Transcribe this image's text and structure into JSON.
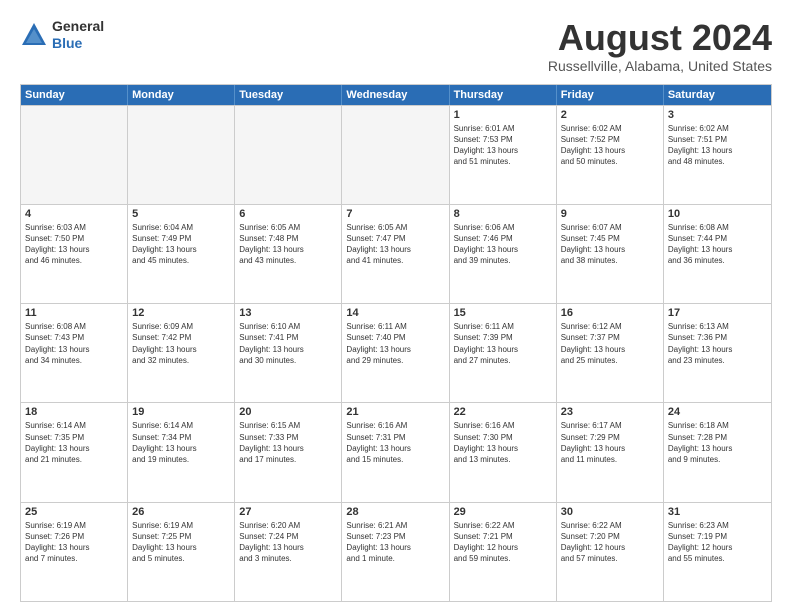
{
  "header": {
    "logo_general": "General",
    "logo_blue": "Blue",
    "month_year": "August 2024",
    "location": "Russellville, Alabama, United States"
  },
  "days_of_week": [
    "Sunday",
    "Monday",
    "Tuesday",
    "Wednesday",
    "Thursday",
    "Friday",
    "Saturday"
  ],
  "rows": [
    [
      {
        "day": "",
        "text": "",
        "empty": true
      },
      {
        "day": "",
        "text": "",
        "empty": true
      },
      {
        "day": "",
        "text": "",
        "empty": true
      },
      {
        "day": "",
        "text": "",
        "empty": true
      },
      {
        "day": "1",
        "text": "Sunrise: 6:01 AM\nSunset: 7:53 PM\nDaylight: 13 hours\nand 51 minutes.",
        "empty": false
      },
      {
        "day": "2",
        "text": "Sunrise: 6:02 AM\nSunset: 7:52 PM\nDaylight: 13 hours\nand 50 minutes.",
        "empty": false
      },
      {
        "day": "3",
        "text": "Sunrise: 6:02 AM\nSunset: 7:51 PM\nDaylight: 13 hours\nand 48 minutes.",
        "empty": false
      }
    ],
    [
      {
        "day": "4",
        "text": "Sunrise: 6:03 AM\nSunset: 7:50 PM\nDaylight: 13 hours\nand 46 minutes.",
        "empty": false
      },
      {
        "day": "5",
        "text": "Sunrise: 6:04 AM\nSunset: 7:49 PM\nDaylight: 13 hours\nand 45 minutes.",
        "empty": false
      },
      {
        "day": "6",
        "text": "Sunrise: 6:05 AM\nSunset: 7:48 PM\nDaylight: 13 hours\nand 43 minutes.",
        "empty": false
      },
      {
        "day": "7",
        "text": "Sunrise: 6:05 AM\nSunset: 7:47 PM\nDaylight: 13 hours\nand 41 minutes.",
        "empty": false
      },
      {
        "day": "8",
        "text": "Sunrise: 6:06 AM\nSunset: 7:46 PM\nDaylight: 13 hours\nand 39 minutes.",
        "empty": false
      },
      {
        "day": "9",
        "text": "Sunrise: 6:07 AM\nSunset: 7:45 PM\nDaylight: 13 hours\nand 38 minutes.",
        "empty": false
      },
      {
        "day": "10",
        "text": "Sunrise: 6:08 AM\nSunset: 7:44 PM\nDaylight: 13 hours\nand 36 minutes.",
        "empty": false
      }
    ],
    [
      {
        "day": "11",
        "text": "Sunrise: 6:08 AM\nSunset: 7:43 PM\nDaylight: 13 hours\nand 34 minutes.",
        "empty": false
      },
      {
        "day": "12",
        "text": "Sunrise: 6:09 AM\nSunset: 7:42 PM\nDaylight: 13 hours\nand 32 minutes.",
        "empty": false
      },
      {
        "day": "13",
        "text": "Sunrise: 6:10 AM\nSunset: 7:41 PM\nDaylight: 13 hours\nand 30 minutes.",
        "empty": false
      },
      {
        "day": "14",
        "text": "Sunrise: 6:11 AM\nSunset: 7:40 PM\nDaylight: 13 hours\nand 29 minutes.",
        "empty": false
      },
      {
        "day": "15",
        "text": "Sunrise: 6:11 AM\nSunset: 7:39 PM\nDaylight: 13 hours\nand 27 minutes.",
        "empty": false
      },
      {
        "day": "16",
        "text": "Sunrise: 6:12 AM\nSunset: 7:37 PM\nDaylight: 13 hours\nand 25 minutes.",
        "empty": false
      },
      {
        "day": "17",
        "text": "Sunrise: 6:13 AM\nSunset: 7:36 PM\nDaylight: 13 hours\nand 23 minutes.",
        "empty": false
      }
    ],
    [
      {
        "day": "18",
        "text": "Sunrise: 6:14 AM\nSunset: 7:35 PM\nDaylight: 13 hours\nand 21 minutes.",
        "empty": false
      },
      {
        "day": "19",
        "text": "Sunrise: 6:14 AM\nSunset: 7:34 PM\nDaylight: 13 hours\nand 19 minutes.",
        "empty": false
      },
      {
        "day": "20",
        "text": "Sunrise: 6:15 AM\nSunset: 7:33 PM\nDaylight: 13 hours\nand 17 minutes.",
        "empty": false
      },
      {
        "day": "21",
        "text": "Sunrise: 6:16 AM\nSunset: 7:31 PM\nDaylight: 13 hours\nand 15 minutes.",
        "empty": false
      },
      {
        "day": "22",
        "text": "Sunrise: 6:16 AM\nSunset: 7:30 PM\nDaylight: 13 hours\nand 13 minutes.",
        "empty": false
      },
      {
        "day": "23",
        "text": "Sunrise: 6:17 AM\nSunset: 7:29 PM\nDaylight: 13 hours\nand 11 minutes.",
        "empty": false
      },
      {
        "day": "24",
        "text": "Sunrise: 6:18 AM\nSunset: 7:28 PM\nDaylight: 13 hours\nand 9 minutes.",
        "empty": false
      }
    ],
    [
      {
        "day": "25",
        "text": "Sunrise: 6:19 AM\nSunset: 7:26 PM\nDaylight: 13 hours\nand 7 minutes.",
        "empty": false
      },
      {
        "day": "26",
        "text": "Sunrise: 6:19 AM\nSunset: 7:25 PM\nDaylight: 13 hours\nand 5 minutes.",
        "empty": false
      },
      {
        "day": "27",
        "text": "Sunrise: 6:20 AM\nSunset: 7:24 PM\nDaylight: 13 hours\nand 3 minutes.",
        "empty": false
      },
      {
        "day": "28",
        "text": "Sunrise: 6:21 AM\nSunset: 7:23 PM\nDaylight: 13 hours\nand 1 minute.",
        "empty": false
      },
      {
        "day": "29",
        "text": "Sunrise: 6:22 AM\nSunset: 7:21 PM\nDaylight: 12 hours\nand 59 minutes.",
        "empty": false
      },
      {
        "day": "30",
        "text": "Sunrise: 6:22 AM\nSunset: 7:20 PM\nDaylight: 12 hours\nand 57 minutes.",
        "empty": false
      },
      {
        "day": "31",
        "text": "Sunrise: 6:23 AM\nSunset: 7:19 PM\nDaylight: 12 hours\nand 55 minutes.",
        "empty": false
      }
    ]
  ]
}
